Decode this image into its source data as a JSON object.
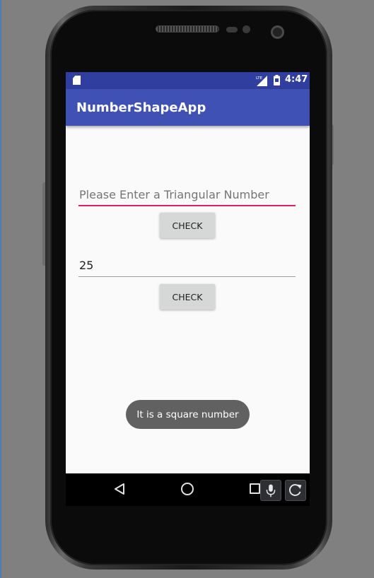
{
  "status_bar": {
    "time": "4:47",
    "network": "LTE"
  },
  "app_bar": {
    "title": "NumberShapeApp"
  },
  "triangular_input": {
    "placeholder": "Please Enter a Triangular Number",
    "value": ""
  },
  "triangular_check_button": {
    "label": "CHECK"
  },
  "square_input": {
    "value": "25"
  },
  "square_check_button": {
    "label": "CHECK"
  },
  "toast": {
    "message": "It is a square number"
  },
  "colors": {
    "primary": "#3f51b5",
    "primary_dark": "#303f9f",
    "accent": "#e91e63",
    "button": "#d6d7d7",
    "toast": "#616161"
  },
  "icons": {
    "status": [
      "sd-card-icon",
      "lte-signal-icon",
      "battery-icon"
    ],
    "navigation": [
      "back-icon",
      "home-icon",
      "recents-icon"
    ],
    "emulator_overlay": [
      "microphone-icon",
      "refresh-icon"
    ]
  }
}
